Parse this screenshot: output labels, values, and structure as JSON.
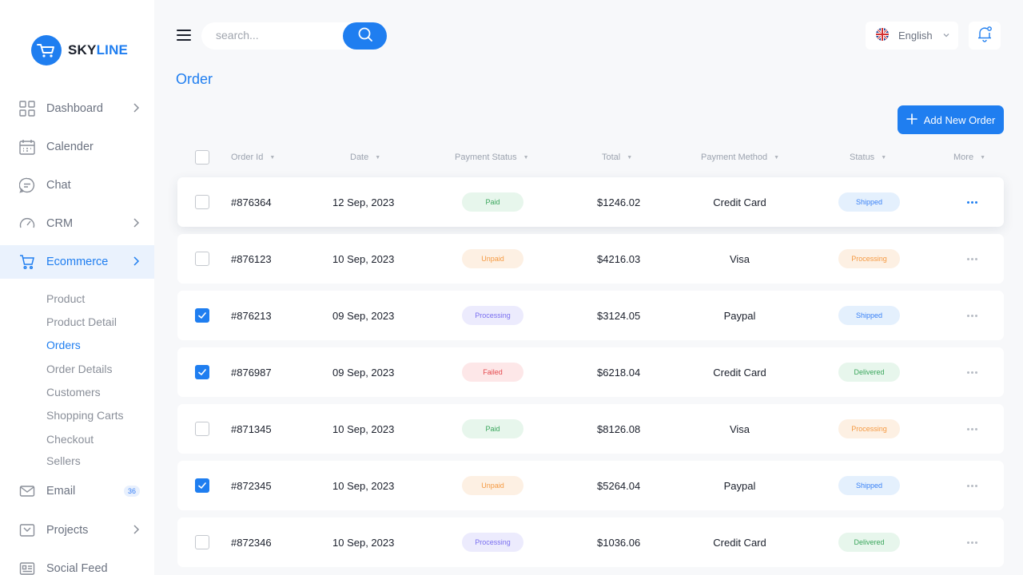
{
  "brand": {
    "part1": "SKY",
    "part2": "LINE"
  },
  "search": {
    "placeholder": "search..."
  },
  "language": {
    "label": "English"
  },
  "page": {
    "title": "Order",
    "add_button": "Add New Order"
  },
  "sidebar": {
    "items": [
      {
        "label": "Dashboard"
      },
      {
        "label": "Calender"
      },
      {
        "label": "Chat"
      },
      {
        "label": "CRM"
      },
      {
        "label": "Ecommerce"
      },
      {
        "label": "Email",
        "badge": "36"
      },
      {
        "label": "Projects"
      },
      {
        "label": "Social Feed"
      }
    ],
    "ecommerce_sub": [
      "Product",
      "Product Detail",
      "Orders",
      "Order Details",
      "Customers",
      "Shopping Carts",
      "Checkout",
      "Sellers"
    ],
    "active_sub": "Orders"
  },
  "table": {
    "headers": {
      "order_id": "Order Id",
      "date": "Date",
      "payment_status": "Payment Status",
      "total": "Total",
      "payment_method": "Payment Method",
      "status": "Status",
      "more": "More"
    },
    "rows": [
      {
        "id": "#876364",
        "date": "12 Sep, 2023",
        "payment": "Paid",
        "total": "$1246.02",
        "method": "Credit Card",
        "status": "Shipped",
        "checked": false
      },
      {
        "id": "#876123",
        "date": "10 Sep, 2023",
        "payment": "Unpaid",
        "total": "$4216.03",
        "method": "Visa",
        "status": "Processing",
        "checked": false
      },
      {
        "id": "#876213",
        "date": "09 Sep, 2023",
        "payment": "Processing",
        "total": "$3124.05",
        "method": "Paypal",
        "status": "Shipped",
        "checked": true
      },
      {
        "id": "#876987",
        "date": "09 Sep, 2023",
        "payment": "Failed",
        "total": "$6218.04",
        "method": "Credit Card",
        "status": "Delivered",
        "checked": true
      },
      {
        "id": "#871345",
        "date": "10 Sep, 2023",
        "payment": "Paid",
        "total": "$8126.08",
        "method": "Visa",
        "status": "Processing",
        "checked": false
      },
      {
        "id": "#872345",
        "date": "10 Sep, 2023",
        "payment": "Unpaid",
        "total": "$5264.04",
        "method": "Paypal",
        "status": "Shipped",
        "checked": true
      },
      {
        "id": "#872346",
        "date": "10 Sep, 2023",
        "payment": "Processing",
        "total": "$1036.06",
        "method": "Credit Card",
        "status": "Delivered",
        "checked": false
      }
    ]
  },
  "colors": {
    "accent": "#1f7ef0",
    "paid": {
      "bg": "#e7f6ec",
      "fg": "#3aa65c"
    },
    "unpaid": {
      "bg": "#fdf0e3",
      "fg": "#f59a43"
    },
    "processing_payment": {
      "bg": "#ecebfd",
      "fg": "#7a6ff0"
    },
    "failed": {
      "bg": "#fde7e8",
      "fg": "#e5484d"
    },
    "shipped": {
      "bg": "#e4f0fd",
      "fg": "#3b82f6"
    },
    "processing_status": {
      "bg": "#fdf0e3",
      "fg": "#f59a43"
    },
    "delivered": {
      "bg": "#e7f6ec",
      "fg": "#3aa65c"
    }
  }
}
